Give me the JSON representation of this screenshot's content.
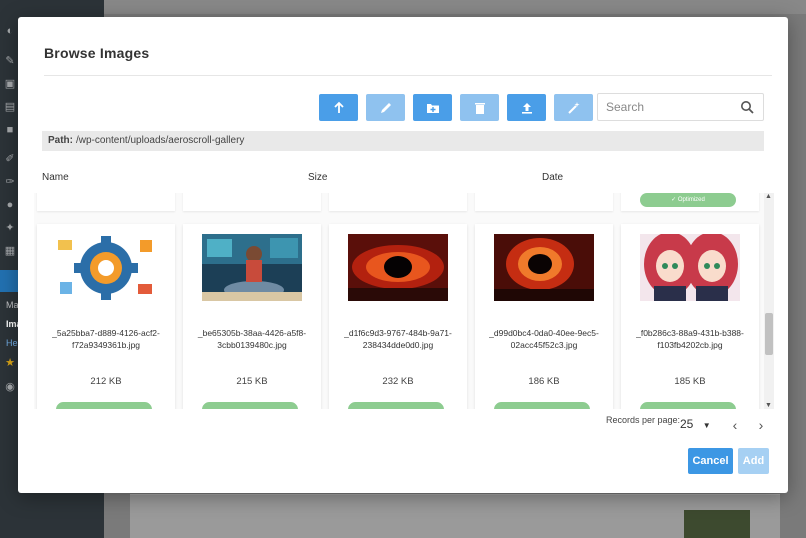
{
  "modal": {
    "title": "Browse Images",
    "search_placeholder": "Search",
    "path_label": "Path:",
    "path_value": "/wp-content/uploads/aeroscroll-gallery"
  },
  "columns": {
    "name": "Name",
    "size": "Size",
    "date": "Date"
  },
  "toolbar": [
    {
      "icon": "arrow-up-icon",
      "state": "active"
    },
    {
      "icon": "pencil-icon",
      "state": "disabled"
    },
    {
      "icon": "new-folder-icon",
      "state": "active"
    },
    {
      "icon": "trash-icon",
      "state": "disabled"
    },
    {
      "icon": "upload-icon",
      "state": "active"
    },
    {
      "icon": "magic-wand-icon",
      "state": "disabled"
    }
  ],
  "top_row": {
    "optimized_label": "Optimized"
  },
  "files": [
    {
      "name_line1": "_5a25bba7-d889-4126-acf2-",
      "name_line2": "f72a9349361b.jpg",
      "size": "212 KB",
      "thumb": "gear-illustration"
    },
    {
      "name_line1": "_be65305b-38aa-4426-a5f8-",
      "name_line2": "3cbb0139480c.jpg",
      "size": "215 KB",
      "thumb": "woman-at-computer"
    },
    {
      "name_line1": "_d1f6c9d3-9767-484b-9a71-",
      "name_line2": "238434dde0d0.jpg",
      "size": "232 KB",
      "thumb": "black-hole-red"
    },
    {
      "name_line1": "_d99d0bc4-0da0-40ee-9ec5-",
      "name_line2": "02acc45f52c3.jpg",
      "size": "186 KB",
      "thumb": "black-hole-orange"
    },
    {
      "name_line1": "_f0b286c3-88a9-431b-b388-",
      "name_line2": "f103fb4202cb.jpg",
      "size": "185 KB",
      "thumb": "anime-girls"
    }
  ],
  "pager": {
    "records_label": "Records per page:",
    "records_value": "25"
  },
  "buttons": {
    "cancel": "Cancel",
    "add": "Add"
  },
  "colors": {
    "primary": "#3c97e4",
    "primary_light": "#8fc2ef",
    "optimized": "#8dcc90"
  }
}
